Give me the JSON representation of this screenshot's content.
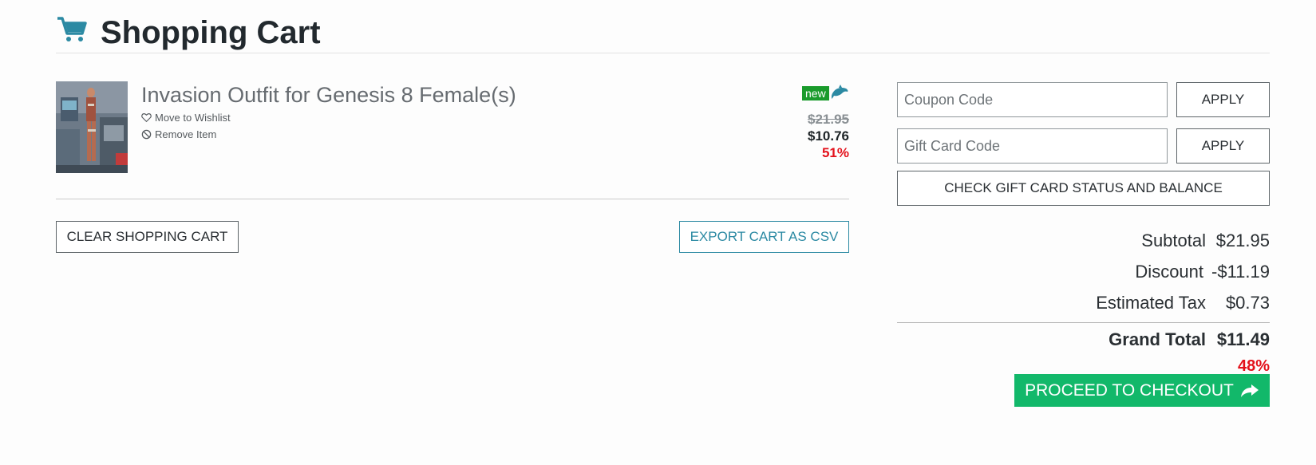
{
  "header": {
    "title": "Shopping Cart",
    "icon": "shopping-cart-icon",
    "accent_color": "#2c8aa3"
  },
  "cart_item": {
    "title": "Invasion Outfit for Genesis 8 Female(s)",
    "wishlist_label": "Move to Wishlist",
    "remove_label": "Remove Item",
    "badge": "new",
    "original_price": "$21.95",
    "sale_price": "$10.76",
    "discount_percent": "51%"
  },
  "actions": {
    "clear_label": "CLEAR SHOPPING CART",
    "export_label": "EXPORT CART AS CSV"
  },
  "coupon": {
    "placeholder": "Coupon Code",
    "apply_label": "APPLY"
  },
  "gift_card": {
    "placeholder": "Gift Card Code",
    "apply_label": "APPLY",
    "check_label": "CHECK GIFT CARD STATUS AND BALANCE"
  },
  "totals": {
    "subtotal_label": "Subtotal",
    "subtotal": "$21.95",
    "discount_label": "Discount",
    "discount": "-$11.19",
    "tax_label": "Estimated Tax",
    "tax": "$0.73",
    "grand_label": "Grand Total",
    "grand": "$11.49",
    "savings_percent": "48%"
  },
  "checkout": {
    "label": "PROCEED TO CHECKOUT",
    "color": "#12b86a"
  }
}
